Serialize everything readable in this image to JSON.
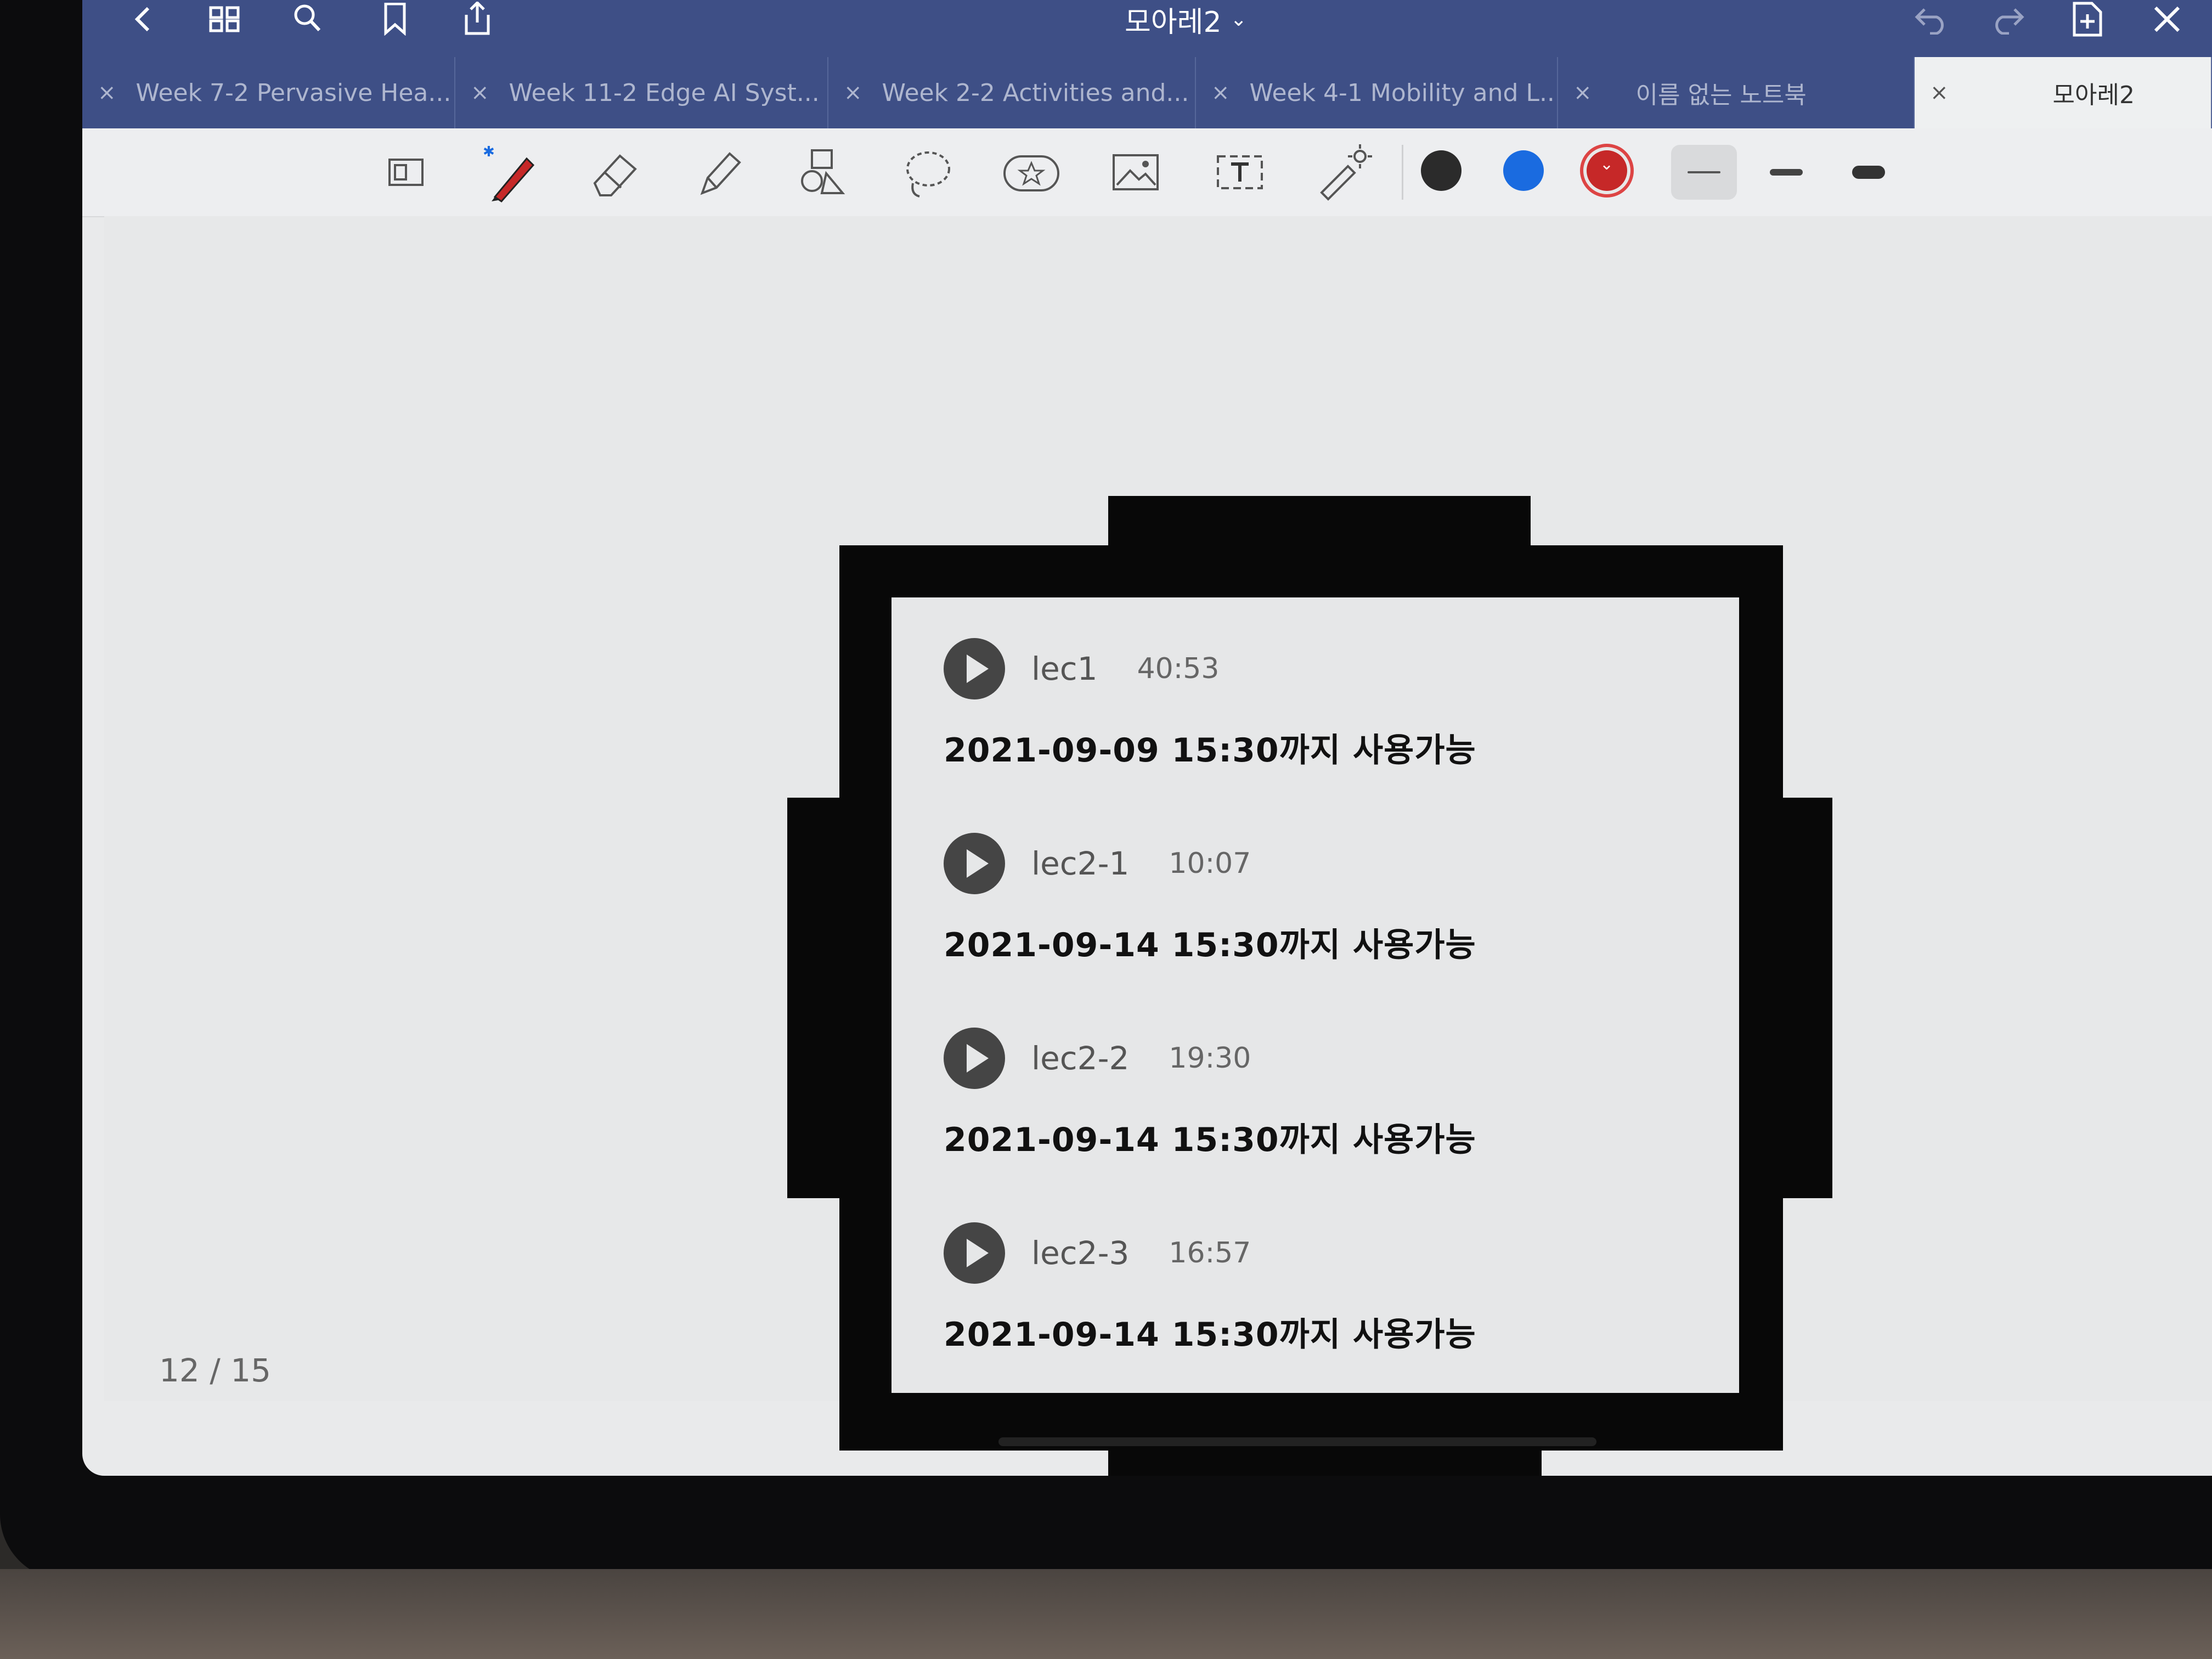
{
  "app": {
    "notebook_title": "모아레2"
  },
  "tabs": [
    {
      "label": "Week 7-2 Pervasive Hea...",
      "active": false
    },
    {
      "label": "Week 11-2 Edge AI Syst...",
      "active": false
    },
    {
      "label": "Week 2-2 Activities and...",
      "active": false
    },
    {
      "label": "Week 4-1 Mobility and L...",
      "active": false
    },
    {
      "label": "이름 없는 노트북",
      "active": false
    },
    {
      "label": "모아레2",
      "active": true
    }
  ],
  "toolbar": {
    "colors": [
      "#2b2b2b",
      "#1a6be0",
      "#c62828"
    ],
    "selected_color": "#c62828"
  },
  "lectures": [
    {
      "name": "lec1",
      "duration": "40:53",
      "availability": "2021-09-09 15:30까지 사용가능"
    },
    {
      "name": "lec2-1",
      "duration": "10:07",
      "availability": "2021-09-14 15:30까지 사용가능"
    },
    {
      "name": "lec2-2",
      "duration": "19:30",
      "availability": "2021-09-14 15:30까지 사용가능"
    },
    {
      "name": "lec2-3",
      "duration": "16:57",
      "availability": "2021-09-14 15:30까지 사용가능"
    }
  ],
  "page_indicator": "12 / 15"
}
